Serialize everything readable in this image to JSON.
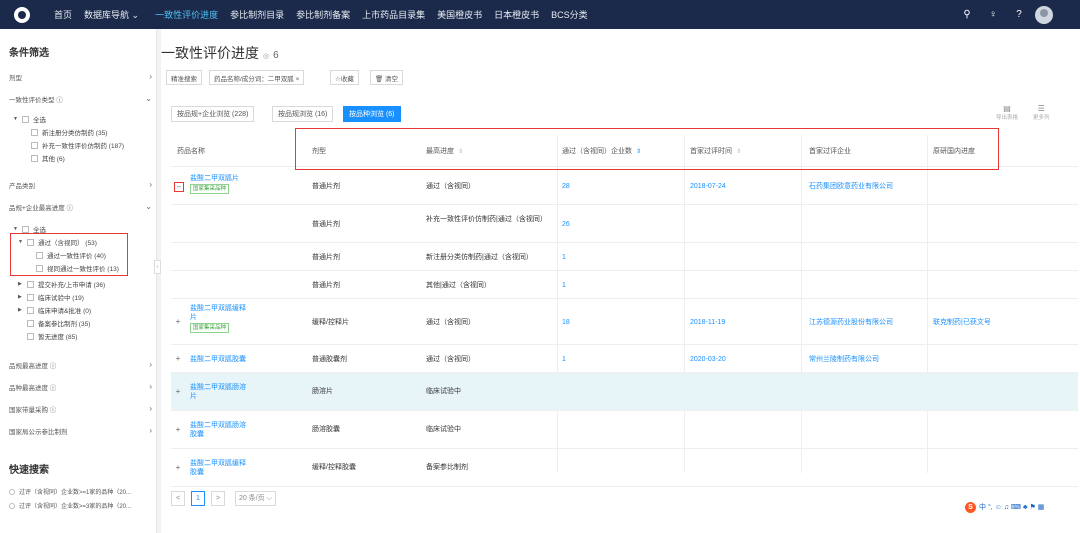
{
  "topnav": {
    "items": [
      "首页",
      "数据库导航 ⌄",
      "一致性评价进度",
      "参比制剂目录",
      "参比制剂备案",
      "上市药品目录集",
      "美国橙皮书",
      "日本橙皮书",
      "BCS分类"
    ],
    "active_index": 2,
    "accent": "#4fc3f7"
  },
  "sidebar": {
    "title": "条件筛选",
    "sections": {
      "dosage": "剂型",
      "eval_type": "一致性评价类型 ⓘ",
      "product_type": "产品类别",
      "progress": "品规+企业最高进度 ⓘ",
      "spec_progress": "品规最高进度 ⓘ",
      "variety_progress": "品种最高进度 ⓘ",
      "procurement": "国家带量采购 ⓘ",
      "publication": "国家局公示参比制剂"
    },
    "eval_items": [
      "全选",
      "新注册分类仿制药 (35)",
      "补充一致性评价仿制药 (187)",
      "其他 (6)"
    ],
    "progress_items": [
      "全选",
      "通过（含视同） (53)",
      "通过一致性评价 (40)",
      "视同通过一致性评价 (13)",
      "提交补充/上市申请 (36)",
      "临床试验中 (19)",
      "临床申请&批准 (0)",
      "备案参比制剂 (35)",
      "暂无进度 (85)"
    ],
    "quick_title": "快速搜索",
    "quick_items": [
      "过评（含视同）企业数>=1家的品种（20...",
      "过评（含视同）企业数>=3家的品种（20..."
    ]
  },
  "main": {
    "title": "一致性评价进度",
    "count": "6",
    "filter_buttons": [
      "精准搜索",
      "药品名称/成分词：二甲双胍 ×",
      "☆收藏",
      "🗑 清空"
    ],
    "tabs": [
      "按品规+企业浏览 (228)",
      "按品规浏览 (16)",
      "按品种浏览 (6)"
    ],
    "active_tab": 2,
    "tools": [
      "导出表格",
      "更多列"
    ],
    "columns": [
      "药品名称",
      "剂型",
      "最高进度",
      "通过（含视同）企业数",
      "首家过评时间",
      "首家过评企业",
      "原研国内进度"
    ],
    "rows": [
      {
        "name": "盐酸二甲双胍片",
        "badge": "国家集采品种",
        "form": "普通片剂",
        "progress": "通过（含视同）",
        "count": "28",
        "date": "2018-07-24",
        "company": "石药集团欧意药业有限公司",
        "orig": ""
      },
      {
        "name": "",
        "badge": "",
        "form": "普通片剂",
        "progress": "补充一致性评价仿制药|通过（含视同）",
        "count": "26",
        "date": "",
        "company": "",
        "orig": ""
      },
      {
        "name": "",
        "badge": "",
        "form": "普通片剂",
        "progress": "新注册分类仿制药|通过（含视同）",
        "count": "1",
        "date": "",
        "company": "",
        "orig": ""
      },
      {
        "name": "",
        "badge": "",
        "form": "普通片剂",
        "progress": "其他|通过（含视同）",
        "count": "1",
        "date": "",
        "company": "",
        "orig": ""
      },
      {
        "name": "盐酸二甲双胍缓释片",
        "badge": "国家集采品种",
        "form": "缓释/控释片",
        "progress": "通过（含视同）",
        "count": "18",
        "date": "2018-11-19",
        "company": "江苏德源药业股份有限公司",
        "orig": "联克制药|已获文号"
      },
      {
        "name": "盐酸二甲双胍胶囊",
        "badge": "",
        "form": "普通胶囊剂",
        "progress": "通过（含视同）",
        "count": "1",
        "date": "2020-03-20",
        "company": "常州兰陵制药有限公司",
        "orig": ""
      },
      {
        "name": "盐酸二甲双胍肠溶片",
        "badge": "",
        "form": "肠溶片",
        "progress": "临床试验中",
        "count": "",
        "date": "",
        "company": "",
        "orig": ""
      },
      {
        "name": "盐酸二甲双胍肠溶胶囊",
        "badge": "",
        "form": "肠溶胶囊",
        "progress": "临床试验中",
        "count": "",
        "date": "",
        "company": "",
        "orig": ""
      },
      {
        "name": "盐酸二甲双胍缓释胶囊",
        "badge": "",
        "form": "缓释/控释胶囊",
        "progress": "备案参比制剂",
        "count": "",
        "date": "",
        "company": "",
        "orig": ""
      }
    ],
    "pager": {
      "prev": "<",
      "page": "1",
      "next": ">",
      "size": "20 条/页 ⌵"
    }
  },
  "ime": {
    "label": "中 °, ☺ ♫ ⌨ ♣ ⚑ ▦"
  }
}
